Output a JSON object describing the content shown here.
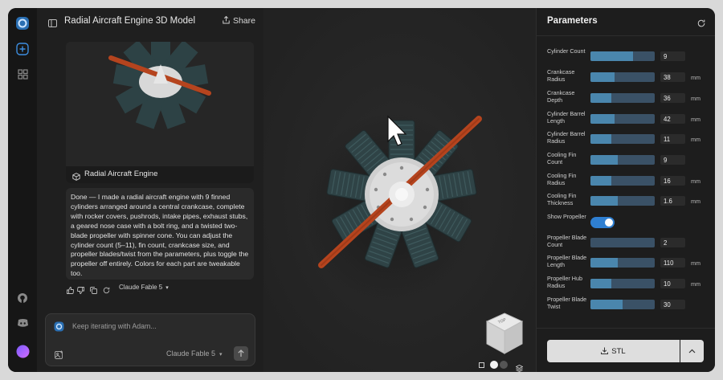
{
  "chat": {
    "title": "Radial Aircraft Engine 3D Model",
    "share_label": "Share",
    "preview_caption": "Radial Aircraft Engine",
    "message": "Done — I made a radial aircraft engine with 9 finned cylinders arranged around a central crankcase, complete with rocker covers, pushrods, intake pipes, exhaust stubs, a geared nose case with a bolt ring, and a twisted two-blade propeller with spinner cone. You can adjust the cylinder count (5–11), fin count, crankcase size, and propeller blades/twist from the parameters, plus toggle the propeller off entirely. Colors for each part are tweakable too.",
    "message_model": "Claude Fable 5",
    "composer_placeholder": "Keep iterating with Adam...",
    "composer_model": "Claude Fable 5"
  },
  "viewcube": {
    "face_label": "TOP"
  },
  "params": {
    "title": "Parameters",
    "rows": [
      {
        "label": "Cylinder Count",
        "value": "9",
        "unit": "",
        "fill": 0.66
      },
      {
        "label": "Crankcase Radius",
        "value": "38",
        "unit": "mm",
        "fill": 0.37
      },
      {
        "label": "Crankcase Depth",
        "value": "36",
        "unit": "mm",
        "fill": 0.33
      },
      {
        "label": "Cylinder Barrel Length",
        "value": "42",
        "unit": "mm",
        "fill": 0.37
      },
      {
        "label": "Cylinder Barrel Radius",
        "value": "11",
        "unit": "mm",
        "fill": 0.33
      },
      {
        "label": "Cooling Fin Count",
        "value": "9",
        "unit": "",
        "fill": 0.42
      },
      {
        "label": "Cooling Fin Radius",
        "value": "16",
        "unit": "mm",
        "fill": 0.33
      },
      {
        "label": "Cooling Fin Thickness",
        "value": "1.6",
        "unit": "mm",
        "fill": 0.42
      },
      {
        "label": "Show Propeller",
        "toggle": true
      },
      {
        "label": "Propeller Blade Count",
        "value": "2",
        "unit": "",
        "fill": 0.0
      },
      {
        "label": "Propeller Blade Length",
        "value": "110",
        "unit": "mm",
        "fill": 0.42
      },
      {
        "label": "Propeller Hub Radius",
        "value": "10",
        "unit": "mm",
        "fill": 0.33
      },
      {
        "label": "Propeller Blade Twist",
        "value": "30",
        "unit": "",
        "fill": 0.5
      }
    ],
    "export_label": "STL"
  },
  "colors": {
    "accent": "#2f7fd1",
    "slider_fill": "#4a86ad",
    "propeller": "#b5441e",
    "cylinders": "#2f4346"
  }
}
